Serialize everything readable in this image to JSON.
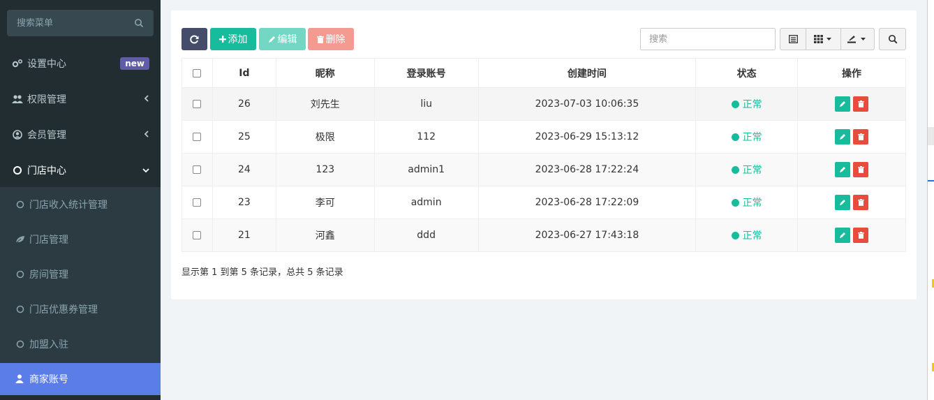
{
  "sidebar": {
    "search_placeholder": "搜索菜单",
    "items": [
      {
        "label": "设置中心",
        "badge": "new"
      },
      {
        "label": "权限管理"
      },
      {
        "label": "会员管理"
      },
      {
        "label": "门店中心"
      }
    ],
    "subitems": [
      {
        "label": "门店收入统计管理"
      },
      {
        "label": "门店管理"
      },
      {
        "label": "房间管理"
      },
      {
        "label": "门店优惠券管理"
      },
      {
        "label": "加盟入驻"
      }
    ],
    "active_item": {
      "label": "商家账号"
    }
  },
  "toolbar": {
    "add_label": "添加",
    "edit_label": "编辑",
    "delete_label": "删除",
    "search_placeholder": "搜索"
  },
  "table": {
    "headers": [
      "Id",
      "昵称",
      "登录账号",
      "创建时间",
      "状态",
      "操作"
    ],
    "rows": [
      {
        "id": "26",
        "nickname": "刘先生",
        "account": "liu",
        "created": "2023-07-03 10:06:35",
        "status": "正常"
      },
      {
        "id": "25",
        "nickname": "极限",
        "account": "112",
        "created": "2023-06-29 15:13:12",
        "status": "正常"
      },
      {
        "id": "24",
        "nickname": "123",
        "account": "admin1",
        "created": "2023-06-28 17:22:24",
        "status": "正常"
      },
      {
        "id": "23",
        "nickname": "李可",
        "account": "admin",
        "created": "2023-06-28 17:22:09",
        "status": "正常"
      },
      {
        "id": "21",
        "nickname": "河鑫",
        "account": "ddd",
        "created": "2023-06-27 17:43:18",
        "status": "正常"
      }
    ]
  },
  "pagination": {
    "summary": "显示第 1 到第 5 条记录，总共 5 条记录"
  },
  "colors": {
    "sidebar_bg": "#222d32",
    "accent": "#18bc9c",
    "active": "#5b7de7",
    "danger": "#e74c3c"
  }
}
